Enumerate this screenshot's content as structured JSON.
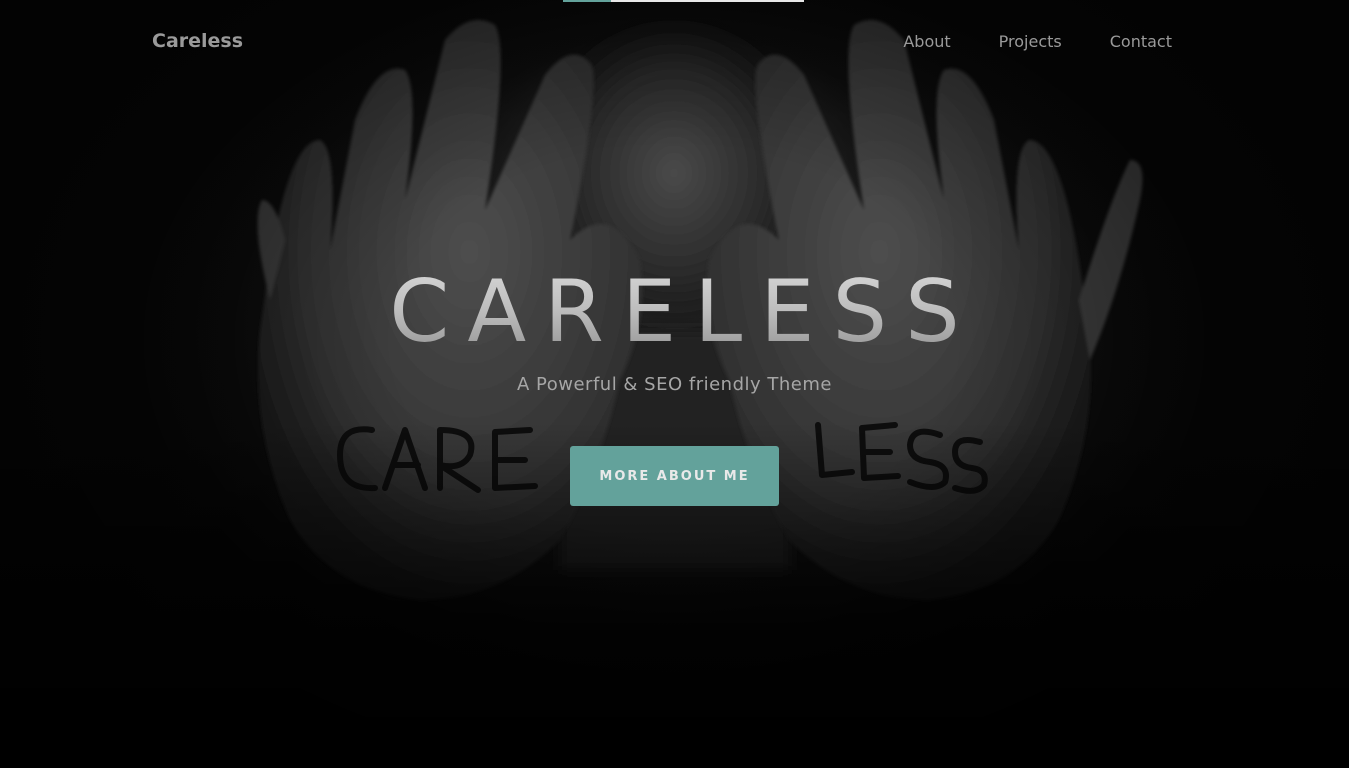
{
  "navbar": {
    "brand": "Careless",
    "links": [
      {
        "label": "About"
      },
      {
        "label": "Projects"
      },
      {
        "label": "Contact"
      }
    ]
  },
  "hero": {
    "title": "CARELESS",
    "subtitle": "A Powerful & SEO friendly Theme",
    "cta_label": "MORE ABOUT ME",
    "background_image_text": [
      "CARE",
      "LESS"
    ]
  },
  "page_loader": {
    "progress": 0.2
  },
  "colors": {
    "accent": "#63a29b",
    "background": "#0b0b0b",
    "nav_text": "#9a9a9a",
    "title_text": "#bdbdbd"
  }
}
